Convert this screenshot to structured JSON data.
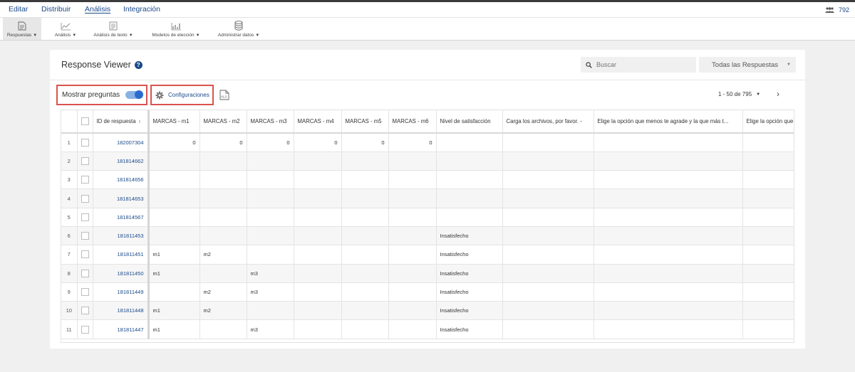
{
  "menu": {
    "items": [
      {
        "label": "Editar",
        "active": false
      },
      {
        "label": "Distribuir",
        "active": false
      },
      {
        "label": "Análisis",
        "active": true
      },
      {
        "label": "Integración",
        "active": false
      }
    ],
    "user_count": "792"
  },
  "toolbar": {
    "items": [
      {
        "label": "Respuestas",
        "icon": "responses-icon",
        "active": true
      },
      {
        "label": "Análisis",
        "icon": "analysis-chart-icon",
        "active": false
      },
      {
        "label": "Análisis de texto",
        "icon": "text-analysis-icon",
        "active": false
      },
      {
        "label": "Modelos de elección",
        "icon": "choice-models-icon",
        "active": false
      },
      {
        "label": "Administrar datos",
        "icon": "database-icon",
        "active": false
      }
    ]
  },
  "viewer": {
    "title": "Response Viewer",
    "search_placeholder": "Buscar",
    "filter_value": "Todas las Respuestas",
    "toggle_label": "Mostrar preguntas",
    "toggle_on": true,
    "config_label": "Configuraciones",
    "export_label": "XLS",
    "pagination": "1 - 50 de 795"
  },
  "table": {
    "columns": [
      "ID de respuesta",
      "MARCAS - m1",
      "MARCAS - m2",
      "MARCAS - m3",
      "MARCAS - m4",
      "MARCAS - m5",
      "MARCAS - m6",
      "Nivel de satisfacción",
      "Carga los archivos, por favor. -",
      "Elige la opción que menos te agrade y la que más t...",
      "Elige la opción que"
    ],
    "rows": [
      {
        "n": "1",
        "id": "182007304",
        "m1": "0",
        "m2": "0",
        "m3": "0",
        "m4": "0",
        "m5": "0",
        "m6": "0",
        "sat": "",
        "file": "",
        "opt1": "",
        "opt2": ""
      },
      {
        "n": "2",
        "id": "181814662",
        "m1": "",
        "m2": "",
        "m3": "",
        "m4": "",
        "m5": "",
        "m6": "",
        "sat": "",
        "file": "",
        "opt1": "",
        "opt2": ""
      },
      {
        "n": "3",
        "id": "181814656",
        "m1": "",
        "m2": "",
        "m3": "",
        "m4": "",
        "m5": "",
        "m6": "",
        "sat": "",
        "file": "",
        "opt1": "",
        "opt2": ""
      },
      {
        "n": "4",
        "id": "181814653",
        "m1": "",
        "m2": "",
        "m3": "",
        "m4": "",
        "m5": "",
        "m6": "",
        "sat": "",
        "file": "",
        "opt1": "",
        "opt2": ""
      },
      {
        "n": "5",
        "id": "181814567",
        "m1": "",
        "m2": "",
        "m3": "",
        "m4": "",
        "m5": "",
        "m6": "",
        "sat": "",
        "file": "",
        "opt1": "",
        "opt2": ""
      },
      {
        "n": "6",
        "id": "181811453",
        "m1": "",
        "m2": "",
        "m3": "",
        "m4": "",
        "m5": "",
        "m6": "",
        "sat": "Insatisfecho",
        "file": "",
        "opt1": "",
        "opt2": ""
      },
      {
        "n": "7",
        "id": "181811451",
        "m1": "m1",
        "m2": "m2",
        "m3": "",
        "m4": "",
        "m5": "",
        "m6": "",
        "sat": "Insatisfecho",
        "file": "",
        "opt1": "",
        "opt2": ""
      },
      {
        "n": "8",
        "id": "181811450",
        "m1": "m1",
        "m2": "",
        "m3": "m3",
        "m4": "",
        "m5": "",
        "m6": "",
        "sat": "Insatisfecho",
        "file": "",
        "opt1": "",
        "opt2": ""
      },
      {
        "n": "9",
        "id": "181811449",
        "m1": "",
        "m2": "m2",
        "m3": "m3",
        "m4": "",
        "m5": "",
        "m6": "",
        "sat": "Insatisfecho",
        "file": "",
        "opt1": "",
        "opt2": ""
      },
      {
        "n": "10",
        "id": "181811448",
        "m1": "m1",
        "m2": "m2",
        "m3": "",
        "m4": "",
        "m5": "",
        "m6": "",
        "sat": "Insatisfecho",
        "file": "",
        "opt1": "",
        "opt2": ""
      },
      {
        "n": "11",
        "id": "181811447",
        "m1": "m1",
        "m2": "",
        "m3": "m3",
        "m4": "",
        "m5": "",
        "m6": "",
        "sat": "Insatisfecho",
        "file": "",
        "opt1": "",
        "opt2": ""
      }
    ]
  },
  "colors": {
    "link": "#1a4a8a",
    "highlight": "#d9534f",
    "toggle": "#2a6bd0"
  }
}
